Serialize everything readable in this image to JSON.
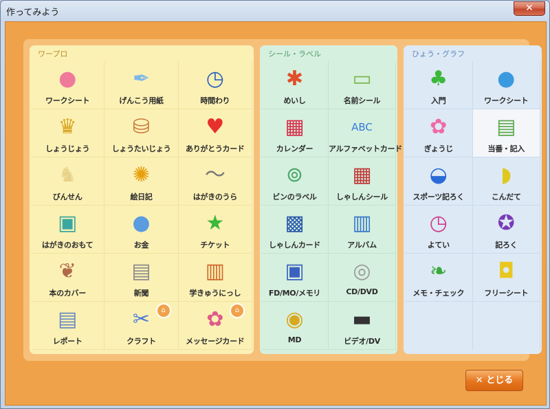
{
  "window": {
    "title": "作ってみよう",
    "close_glyph": "✕"
  },
  "panels": [
    {
      "heading": "ワープロ",
      "items": [
        {
          "label": "ワークシート",
          "icon": "pink-blob-icon",
          "glyph": "●",
          "color": "#f07a9a"
        },
        {
          "label": "げんこう用紙",
          "icon": "feather-pen-icon",
          "glyph": "✒",
          "color": "#7fb8e8"
        },
        {
          "label": "時間わり",
          "icon": "clock-icon",
          "glyph": "◷",
          "color": "#2a62b8"
        },
        {
          "label": "しょうじょう",
          "icon": "trophy-icon",
          "glyph": "♛",
          "color": "#d9a520"
        },
        {
          "label": "しょうたいじょう",
          "icon": "cake-icon",
          "glyph": "⛁",
          "color": "#c97a3a"
        },
        {
          "label": "ありがとうカード",
          "icon": "heart-icon",
          "glyph": "♥",
          "color": "#e8302a"
        },
        {
          "label": "びんせん",
          "icon": "deer-icon",
          "glyph": "♞",
          "color": "#e8d38a"
        },
        {
          "label": "絵日記",
          "icon": "sunflower-icon",
          "glyph": "✺",
          "color": "#e8a010"
        },
        {
          "label": "はがきのうら",
          "icon": "bird-icon",
          "glyph": "〜",
          "color": "#777777"
        },
        {
          "label": "はがきのおもて",
          "icon": "stamp-icon",
          "glyph": "▣",
          "color": "#3aa8a0"
        },
        {
          "label": "お金",
          "icon": "coin-purse-icon",
          "glyph": "●",
          "color": "#5b9be0"
        },
        {
          "label": "チケット",
          "icon": "star-icon",
          "glyph": "★",
          "color": "#3cb83a"
        },
        {
          "label": "本のカバー",
          "icon": "leaf-icon",
          "glyph": "❦",
          "color": "#b06a4a"
        },
        {
          "label": "新聞",
          "icon": "newspaper-icon",
          "glyph": "▤",
          "color": "#8a8a8a"
        },
        {
          "label": "学きゅうにっし",
          "icon": "notebook-icon",
          "glyph": "▥",
          "color": "#d0682a"
        },
        {
          "label": "レポート",
          "icon": "report-icon",
          "glyph": "▤",
          "color": "#6a8ac0"
        },
        {
          "label": "クラフト",
          "icon": "scissors-icon",
          "glyph": "✂",
          "color": "#4a7ad8"
        },
        {
          "label": "メッセージカード",
          "icon": "message-card-icon",
          "glyph": "✿",
          "color": "#e05a8a"
        }
      ],
      "badges": [
        16,
        17
      ]
    },
    {
      "heading": "シール・ラベル",
      "items": [
        {
          "label": "めいし",
          "icon": "crab-icon",
          "glyph": "✱",
          "color": "#e0502a"
        },
        {
          "label": "名前シール",
          "icon": "name-tag-icon",
          "glyph": "▭",
          "color": "#7ab84a"
        },
        {
          "label": "カレンダー",
          "icon": "calendar-icon",
          "glyph": "▦",
          "color": "#d8304a"
        },
        {
          "label": "アルファベットカード",
          "icon": "abc-blocks-icon",
          "glyph": "ABC",
          "color": "#3a7ad8"
        },
        {
          "label": "ビンのラベル",
          "icon": "jar-icon",
          "glyph": "⊚",
          "color": "#4aa86a"
        },
        {
          "label": "しゃしんシール",
          "icon": "photo-sticker-icon",
          "glyph": "▦",
          "color": "#c03a3a"
        },
        {
          "label": "しゃしんカード",
          "icon": "photo-card-icon",
          "glyph": "▩",
          "color": "#2a5aa8"
        },
        {
          "label": "アルバム",
          "icon": "album-icon",
          "glyph": "▥",
          "color": "#3a78c8"
        },
        {
          "label": "FD/MO/メモリ",
          "icon": "floppy-disk-icon",
          "glyph": "▣",
          "color": "#3a62c0"
        },
        {
          "label": "CD/DVD",
          "icon": "cd-icon",
          "glyph": "◎",
          "color": "#9a9a9a"
        },
        {
          "label": "MD",
          "icon": "minidisc-icon",
          "glyph": "◉",
          "color": "#d8a820"
        },
        {
          "label": "ビデオ/DV",
          "icon": "videotape-icon",
          "glyph": "▬",
          "color": "#333333"
        }
      ],
      "badges": []
    },
    {
      "heading": "ひょう・グラフ",
      "items": [
        {
          "label": "入門",
          "icon": "sprout-icon",
          "glyph": "♣",
          "color": "#3cb83a"
        },
        {
          "label": "ワークシート",
          "icon": "blue-blob-icon",
          "glyph": "●",
          "color": "#3a9ae0"
        },
        {
          "label": "ぎょうじ",
          "icon": "sakura-icon",
          "glyph": "✿",
          "color": "#f06aa8"
        },
        {
          "label": "当番・記入",
          "icon": "clipboard-icon",
          "glyph": "▤",
          "color": "#5aa84a"
        },
        {
          "label": "スポーツ記ろく",
          "icon": "cap-icon",
          "glyph": "◒",
          "color": "#2a6ad8"
        },
        {
          "label": "こんだて",
          "icon": "pan-icon",
          "glyph": "◗",
          "color": "#e0c820"
        },
        {
          "label": "よてい",
          "icon": "wall-clock-icon",
          "glyph": "◷",
          "color": "#d03a8a"
        },
        {
          "label": "記ろく",
          "icon": "medal-icon",
          "glyph": "✪",
          "color": "#7a3ab8"
        },
        {
          "label": "メモ・チェック",
          "icon": "green-leaf-icon",
          "glyph": "❧",
          "color": "#3aa83a"
        },
        {
          "label": "フリーシート",
          "icon": "bag-icon",
          "glyph": "◘",
          "color": "#e8c820"
        },
        {
          "label": "",
          "icon": "",
          "glyph": "",
          "color": "#000000"
        },
        {
          "label": "",
          "icon": "",
          "glyph": "",
          "color": "#000000"
        }
      ],
      "badges": [],
      "highlight": 3
    }
  ],
  "badge_glyph": "⌂",
  "footer": {
    "close_icon": "✕",
    "close_label": "とじる"
  }
}
